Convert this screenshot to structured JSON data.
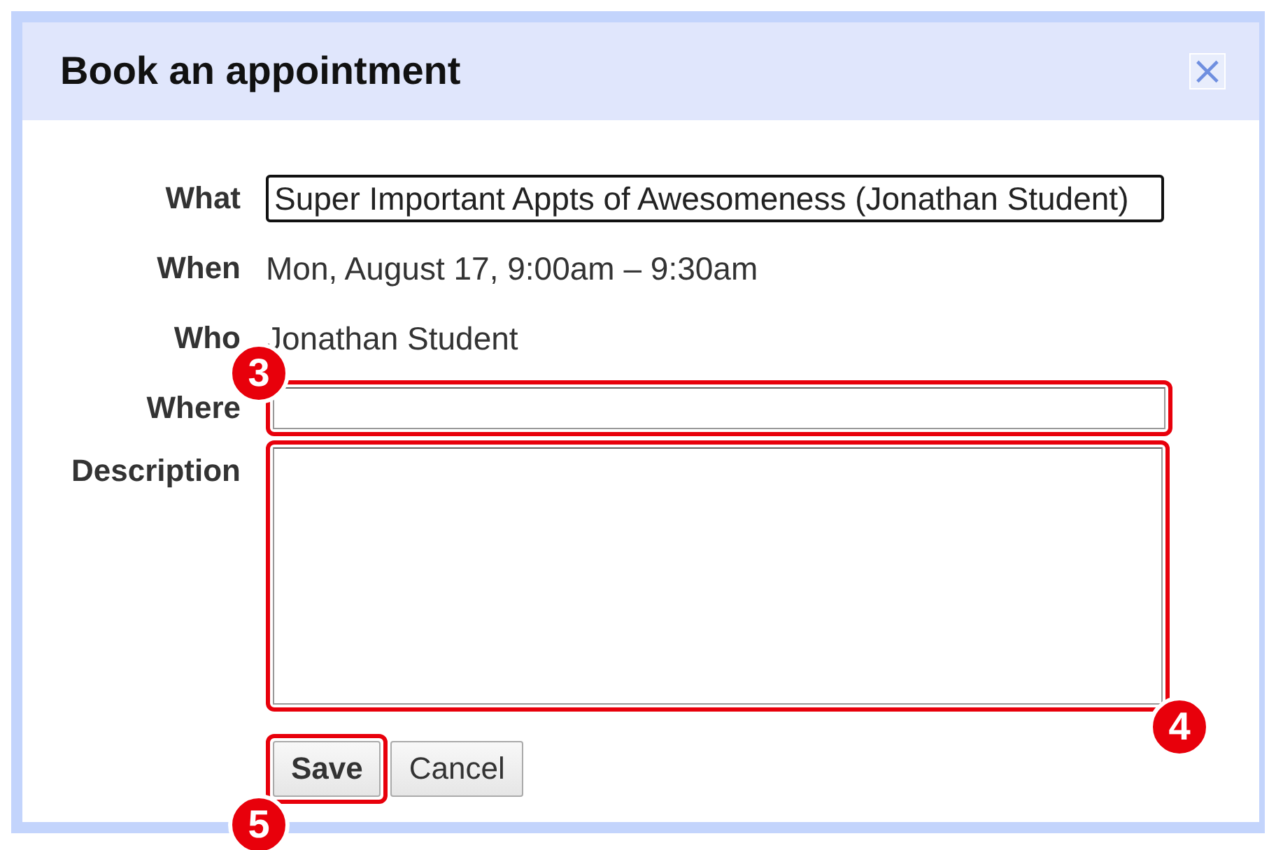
{
  "dialog": {
    "title": "Book an appointment",
    "close": "×"
  },
  "fields": [
    {
      "label": "What",
      "kind": "input",
      "value": "Super Important Appts of Awesomeness (Jonathan Student)",
      "focused": true
    },
    {
      "label": "When",
      "kind": "text",
      "value": "Mon, August 17, 9:00am – 9:30am"
    },
    {
      "label": "Who",
      "kind": "text",
      "value": "Jonathan Student"
    },
    {
      "label": "Where",
      "kind": "input",
      "callout": "3"
    },
    {
      "label": "Description",
      "kind": "textarea",
      "callout": "4"
    }
  ],
  "buttons": [
    {
      "label": "Save",
      "primary": true,
      "callout": "5"
    },
    {
      "label": "Cancel",
      "primary": false
    }
  ]
}
